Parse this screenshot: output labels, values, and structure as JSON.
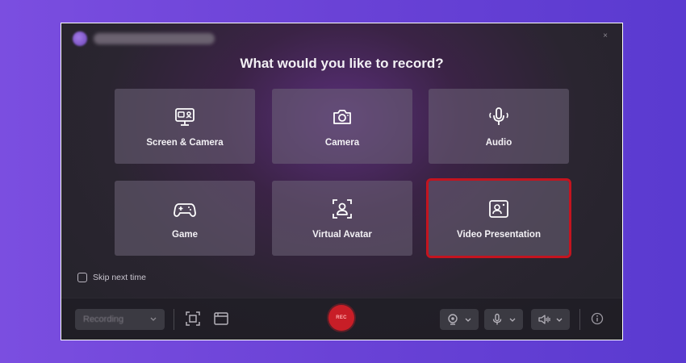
{
  "window": {
    "title": "",
    "heading": "What would you like to record?",
    "close_glyph": "×"
  },
  "tiles": [
    {
      "label": "Screen & Camera",
      "icon": "screen-camera-icon",
      "selected": false
    },
    {
      "label": "Camera",
      "icon": "camera-icon",
      "selected": false
    },
    {
      "label": "Audio",
      "icon": "microphone-icon",
      "selected": false
    },
    {
      "label": "Game",
      "icon": "gamepad-icon",
      "selected": false
    },
    {
      "label": "Virtual Avatar",
      "icon": "avatar-icon",
      "selected": false
    },
    {
      "label": "Video Presentation",
      "icon": "presentation-icon",
      "selected": true
    }
  ],
  "skip": {
    "label": "Skip next time",
    "checked": false
  },
  "toolbar": {
    "mode_value": "Recording",
    "rec_label": "REC"
  },
  "colors": {
    "accent_selected": "#c4141f",
    "record": "#c81e27",
    "background": "#6a42d6"
  }
}
